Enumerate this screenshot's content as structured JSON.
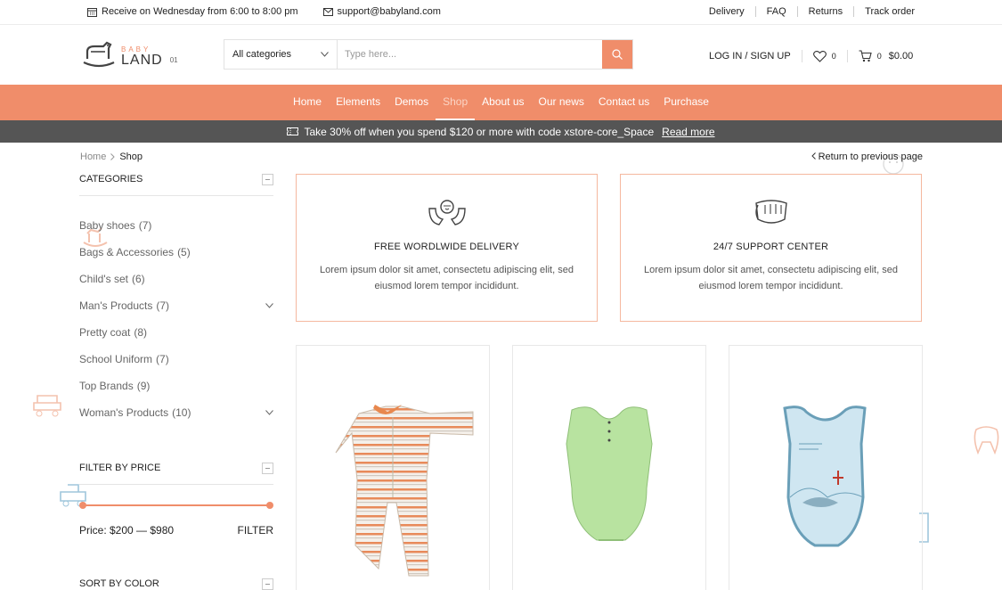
{
  "topbar": {
    "delivery_info": "Receive on Wednesday from 6:00 to 8:00 pm",
    "email": "support@babyland.com",
    "links": [
      "Delivery",
      "FAQ",
      "Returns",
      "Track order"
    ]
  },
  "logo": {
    "top": "BABY",
    "main": "LAND",
    "tag": "01"
  },
  "search": {
    "category": "All categories",
    "placeholder": "Type here..."
  },
  "account": {
    "login": "LOG IN / SIGN UP",
    "wishlist_count": "0",
    "cart_count": "0",
    "cart_total": "$0.00"
  },
  "nav": {
    "items": [
      "Home",
      "Elements",
      "Demos",
      "Shop",
      "About us",
      "Our news",
      "Contact us",
      "Purchase"
    ],
    "active": "Shop"
  },
  "promo": {
    "text": "Take 30% off when you spend $120 or more with code xstore-core_Space",
    "link": "Read more"
  },
  "breadcrumb": {
    "home": "Home",
    "current": "Shop",
    "back": "Return to previous page"
  },
  "categories": {
    "title": "CATEGORIES",
    "items": [
      {
        "label": "Baby shoes",
        "count": "(7)",
        "expand": false
      },
      {
        "label": "Bags & Accessories",
        "count": "(5)",
        "expand": false
      },
      {
        "label": "Child's set",
        "count": "(6)",
        "expand": false
      },
      {
        "label": "Man's Products",
        "count": "(7)",
        "expand": true
      },
      {
        "label": "Pretty coat",
        "count": "(8)",
        "expand": false
      },
      {
        "label": "School Uniform",
        "count": "(7)",
        "expand": false
      },
      {
        "label": "Top Brands",
        "count": "(9)",
        "expand": false
      },
      {
        "label": "Woman's Products",
        "count": "(10)",
        "expand": true
      }
    ]
  },
  "filter_price": {
    "title": "FILTER BY PRICE",
    "label": "Price: $200 — $980",
    "button": "FILTER"
  },
  "sort_color": {
    "title": "SORT BY COLOR"
  },
  "info_boxes": [
    {
      "title": "FREE WORDLWIDE DELIVERY",
      "text": "Lorem ipsum dolor sit amet, consectetu adipiscing elit, sed eiusmod lorem tempor incididunt.",
      "icon": "delivery-hands-icon"
    },
    {
      "title": "24/7 SUPPORT CENTER",
      "text": "Lorem ipsum dolor sit amet, consectetu adipiscing elit, sed eiusmod lorem tempor incididunt.",
      "icon": "support-diaper-icon"
    }
  ],
  "products": [
    {
      "name": "striped-sleepsuit",
      "colors": [
        "#f5f0ea",
        "#e88a5a"
      ]
    },
    {
      "name": "green-bodysuit",
      "colors": [
        "#b8e3a0"
      ]
    },
    {
      "name": "blue-tank-bodysuit",
      "colors": [
        "#cfe6f1",
        "#6a9fb8"
      ]
    }
  ],
  "colors": {
    "accent": "#f08d6a",
    "promo_bg": "#555555"
  }
}
